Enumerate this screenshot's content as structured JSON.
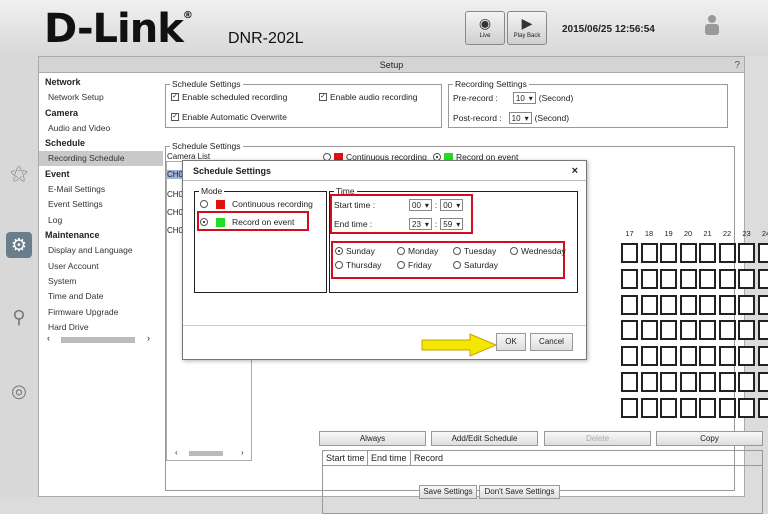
{
  "header": {
    "logo": "D-Link",
    "logo_mark": "®",
    "model": "DNR-202L",
    "live_label": "Live",
    "playback_label": "Play Back",
    "datetime": "2015/06/25 12:56:54"
  },
  "setup_title": "Setup",
  "sidebar": {
    "sections": [
      {
        "title": "Network",
        "items": [
          "Network Setup"
        ]
      },
      {
        "title": "Camera",
        "items": [
          "Audio and Video"
        ]
      },
      {
        "title": "Schedule",
        "items": [
          "Recording Schedule"
        ]
      },
      {
        "title": "Event",
        "items": [
          "E-Mail Settings",
          "Event Settings",
          "Log"
        ]
      },
      {
        "title": "Maintenance",
        "items": [
          "Display and Language",
          "User Account",
          "System",
          "Time and Date",
          "Firmware Upgrade",
          "Hard Drive"
        ]
      }
    ]
  },
  "schedule_settings": {
    "legend": "Schedule Settings",
    "enable_scheduled": "Enable scheduled recording",
    "enable_audio": "Enable audio recording",
    "enable_overwrite": "Enable Automatic Overwrite"
  },
  "recording_settings": {
    "legend": "Recording Settings",
    "prerecord_label": "Pre-record :",
    "prerecord_value": "10",
    "postrecord_label": "Post-record :",
    "postrecord_value": "10",
    "unit": "(Second)"
  },
  "schedule_panel": {
    "legend": "Schedule Settings",
    "camera_list": "Camera List",
    "cameras": [
      "CH0",
      "CH0",
      "CH0",
      "CH0"
    ],
    "legend_continuous": "Continuous recording",
    "legend_event": "Record on event",
    "hours_visible": [
      "17",
      "18",
      "19",
      "20",
      "21",
      "22",
      "23",
      "24"
    ],
    "btn_always": "Always",
    "btn_add_edit": "Add/Edit Schedule",
    "btn_delete": "Delete",
    "btn_copy": "Copy",
    "table_headers": [
      "Start time",
      "End time",
      "Record"
    ]
  },
  "footer": {
    "save": "Save Settings",
    "dont_save": "Don't Save Settings"
  },
  "dialog": {
    "title": "Schedule Settings",
    "close": "×",
    "mode_legend": "Mode",
    "mode_continuous": "Continuous recording",
    "mode_event": "Record on event",
    "time_legend": "Time",
    "start_label": "Start time :",
    "start_h": "00",
    "start_m": "00",
    "end_label": "End time :",
    "end_h": "23",
    "end_m": "59",
    "colon": ":",
    "days": [
      "Sunday",
      "Monday",
      "Tuesday",
      "Wednesday",
      "Thursday",
      "Friday",
      "Saturday"
    ],
    "ok": "OK",
    "cancel": "Cancel"
  },
  "colors": {
    "continuous": "#e01010",
    "event": "#22dd22",
    "highlight": "#d01020",
    "arrow": "#f5e800"
  }
}
